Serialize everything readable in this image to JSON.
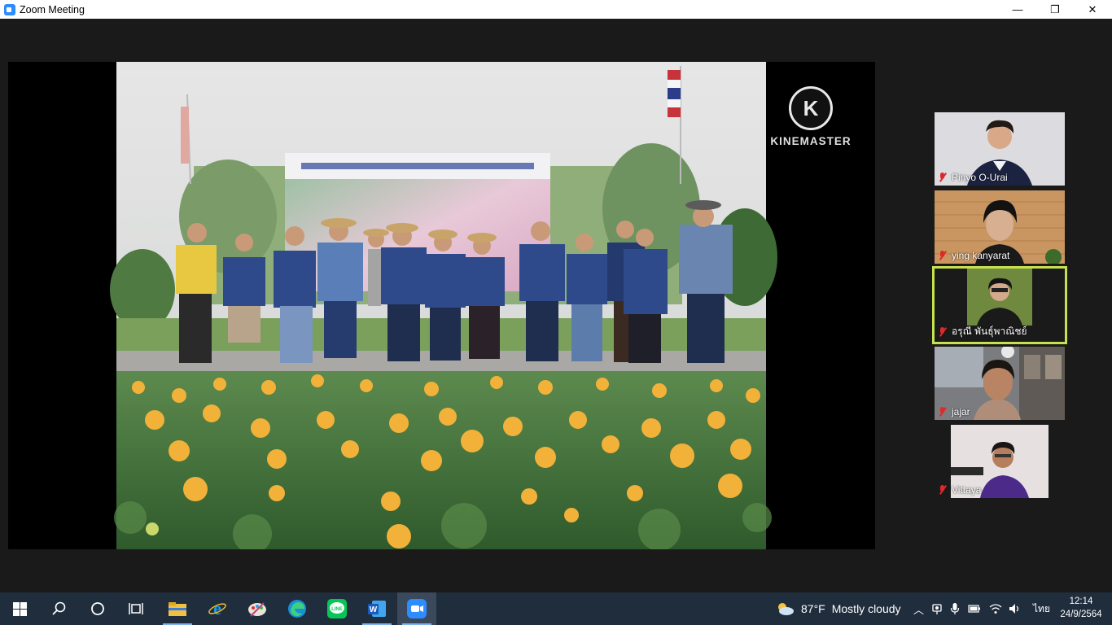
{
  "window": {
    "title": "Zoom Meeting",
    "minimize_glyph": "—",
    "restore_glyph": "❐",
    "close_glyph": "✕"
  },
  "share": {
    "watermark": "KINEMASTER",
    "watermark_letter": "K"
  },
  "participants": [
    {
      "name": "Pinyo O-Urai",
      "muted": true,
      "active": false
    },
    {
      "name": "ying  kanyarat",
      "muted": true,
      "active": false
    },
    {
      "name": "อรุณี พันธุ์พาณิชย์",
      "muted": true,
      "active": true
    },
    {
      "name": "jajar",
      "muted": true,
      "active": false
    },
    {
      "name": "Vittaya",
      "muted": true,
      "active": false
    }
  ],
  "taskbar": {
    "icons": [
      "windows-start-icon",
      "search-icon",
      "cortana-icon",
      "task-view-icon",
      "file-explorer-icon",
      "internet-explorer-icon",
      "paint-icon",
      "edge-icon",
      "line-icon",
      "word-icon",
      "zoom-icon"
    ],
    "weather_temp": "87°F",
    "weather_text": "Mostly cloudy",
    "language": "ไทย",
    "time": "12:14",
    "date": "24/9/2564"
  },
  "colors": {
    "active_speaker_border": "#c6e14f",
    "mute_red": "#e02828",
    "taskbar_bg": "#1f2d3d",
    "meeting_bg": "#1a1a1a"
  }
}
